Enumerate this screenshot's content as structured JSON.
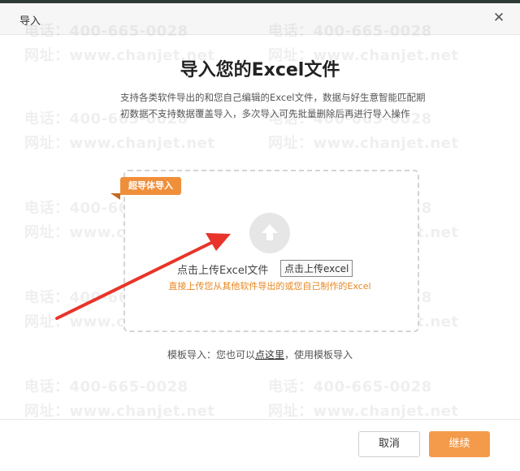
{
  "dialog": {
    "title": "导入",
    "close_glyph": "✕"
  },
  "main": {
    "title": "导入您的Excel文件",
    "description": "支持各类软件导出的和您自己编辑的Excel文件，数据与好生意智能匹配期初数据不支持数据覆盖导入，多次导入可先批量删除后再进行导入操作"
  },
  "dropzone": {
    "ribbon_label": "超导体导入",
    "upload_icon": "upload-arrow-icon",
    "upload_label": "点击上传Excel文件",
    "upload_button": "点击上传excel",
    "hint": "直接上传您从其他软件导出的或您自己制作的Excel"
  },
  "template": {
    "prefix": "模板导入：您也可以",
    "link": "点这里",
    "suffix": "，使用模板导入"
  },
  "footer": {
    "cancel_label": "取消",
    "continue_label": "继续"
  },
  "watermark": {
    "phone": "电话：400-665-0028",
    "site": "网址：www.chanjet.net"
  },
  "colors": {
    "accent": "#f39b4a",
    "ribbon": "#f08f3a",
    "hint": "#e8861f",
    "annotation_arrow": "#e8342a"
  }
}
